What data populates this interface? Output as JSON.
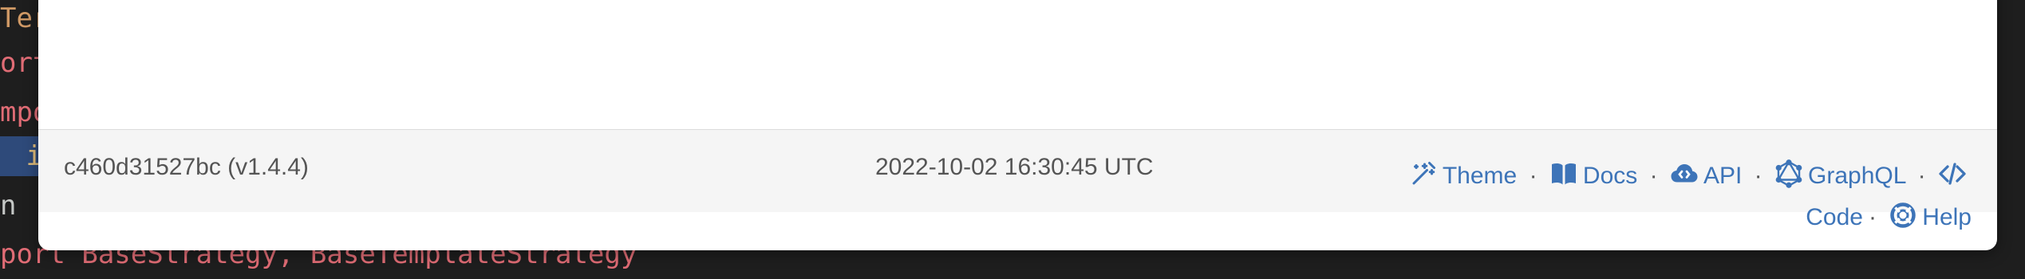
{
  "code": {
    "lines": [
      "Ter",
      "ort",
      "mpo",
      " in",
      "n ",
      "port BaseStrategy, BaseTemplateStrategy"
    ]
  },
  "footer": {
    "version": "c460d31527bc (v1.4.4)",
    "timestamp": "2022-10-02 16:30:45 UTC",
    "links": {
      "theme": "Theme",
      "docs": "Docs",
      "api": "API",
      "graphql": "GraphQL",
      "code": "Code",
      "help": "Help"
    },
    "separator": "·",
    "icons": {
      "theme": "magic-wand-icon",
      "docs": "book-icon",
      "api": "cloud-icon",
      "graphql": "graphql-icon",
      "code": "code-icon",
      "help": "lifebuoy-icon"
    }
  },
  "colors": {
    "link": "#3d74b8",
    "footer_bg": "#f5f5f5",
    "text_muted": "#555555",
    "editor_bg": "#1e1e1e"
  }
}
